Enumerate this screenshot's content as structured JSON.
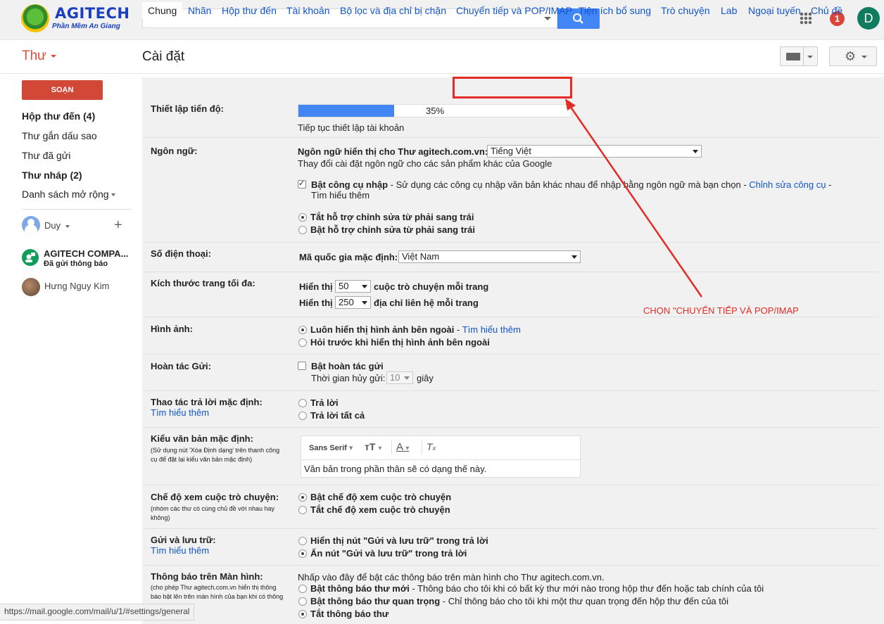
{
  "header": {
    "logo_title": "AGITECH",
    "logo_subtitle": "Phần Mềm An Giang",
    "notification_count": "1",
    "avatar_letter": "D"
  },
  "subheader": {
    "app_title": "Thư",
    "page_title": "Cài đặt"
  },
  "sidebar": {
    "compose_label": "SOẠN",
    "items": [
      {
        "label": "Hộp thư đến (4)",
        "bold": true
      },
      {
        "label": "Thư gắn dấu sao",
        "bold": false
      },
      {
        "label": "Thư đã gửi",
        "bold": false
      },
      {
        "label": "Thư nháp (2)",
        "bold": true
      },
      {
        "label": "Danh sách mở rộng",
        "bold": false
      }
    ],
    "hangouts_user": "Duy",
    "contacts": [
      {
        "name": "AGITECH COMPA...",
        "status": "Đã gửi thông báo"
      },
      {
        "name": "Hưng Nguy Kim",
        "status": ""
      }
    ]
  },
  "tabs": [
    {
      "label": "Chung",
      "active": true
    },
    {
      "label": "Nhãn"
    },
    {
      "label": "Hộp thư đến"
    },
    {
      "label": "Tài khoản"
    },
    {
      "label": "Bộ lọc và địa chỉ bị chặn"
    },
    {
      "label": "Chuyển tiếp và POP/IMAP",
      "highlighted": true
    },
    {
      "label": "Tiện ích bổ sung"
    },
    {
      "label": "Trò chuyện"
    },
    {
      "label": "Lab"
    },
    {
      "label": "Ngoại tuyến"
    },
    {
      "label": "Chủ đề"
    }
  ],
  "settings": {
    "progress": {
      "label": "Thiết lập tiến độ:",
      "percent_value": 35,
      "percent_text": "35%",
      "link": "Tiếp tục thiết lập tài khoản"
    },
    "language": {
      "label": "Ngôn ngữ:",
      "display_label": "Ngôn ngữ hiển thị cho Thư agitech.com.vn:",
      "display_value": "Tiếng Việt",
      "change_link": "Thay đổi cài đặt ngôn ngữ cho các sản phẩm khác của Google",
      "input_tools_bold": "Bật công cụ nhập",
      "input_tools_text": " - Sử dụng các công cụ nhập văn bản khác nhau để nhập bằng ngôn ngữ mà bạn chọn - ",
      "input_tools_link": "Chỉnh sửa công cụ",
      "input_tools_dash": " -",
      "learn_more": "Tìm hiểu thêm",
      "rtl_off": "Tắt hỗ trợ chỉnh sửa từ phải sang trái",
      "rtl_on": "Bật hỗ trợ chỉnh sửa từ phải sang trái"
    },
    "phone": {
      "label": "Số điện thoại:",
      "country_label": "Mã quốc gia mặc định:",
      "country_value": "Việt Nam"
    },
    "page_size": {
      "label": "Kích thước trang tối đa:",
      "show": "Hiển thị",
      "conv_value": "50",
      "conv_text": "cuộc trò chuyện mỗi trang",
      "contacts_value": "250",
      "contacts_text": "địa chỉ liên hệ mỗi trang"
    },
    "images": {
      "label": "Hình ảnh:",
      "always": "Luôn hiển thị hình ảnh bên ngoài",
      "always_sep": " - ",
      "learn_more": "Tìm hiểu thêm",
      "ask": "Hỏi trước khi hiển thị hình ảnh bên ngoài"
    },
    "undo_send": {
      "label": "Hoàn tác Gửi:",
      "enable": "Bật hoàn tác gửi",
      "period_label": "Thời gian hủy gửi:",
      "period_value": "10",
      "seconds": "giây"
    },
    "reply": {
      "label": "Thao tác trả lời mặc định:",
      "learn_more": "Tìm hiểu thêm",
      "reply": "Trả lời",
      "reply_all": "Trả lời tất cả"
    },
    "text_style": {
      "label": "Kiểu văn bản mặc định:",
      "sub": "(Sử dụng nút 'Xóa Định dạng' trên thanh công cụ để đặt lại kiểu văn bản mặc định)",
      "font": "Sans Serif",
      "preview": "Văn bản trong phần thân sẽ có dạng thế này."
    },
    "conversation": {
      "label": "Chế độ xem cuộc trò chuyện:",
      "sub": "(nhóm các thư có cùng chủ đề với nhau hay không)",
      "on": "Bật chế độ xem cuộc trò chuyện",
      "off": "Tắt chế độ xem cuộc trò chuyện"
    },
    "send_archive": {
      "label": "Gửi và lưu trữ:",
      "learn_more": "Tìm hiểu thêm",
      "show": "Hiển thị nút \"Gửi và lưu trữ\" trong trả lời",
      "hide": "Ẩn nút \"Gửi và lưu trữ\" trong trả lời"
    },
    "desktop_notif": {
      "label": "Thông báo trên Màn hình:",
      "sub": "(cho phép Thư agitech.com.vn hiển thị thông báo bật lên trên màn hình của bạn khi có thông",
      "enable_link": "Nhấp vào đây để bật các thông báo trên màn hình cho Thư agitech.com.vn.",
      "new_mail_bold": "Bật thông báo thư mới",
      "new_mail_text": " - Thông báo cho tôi khi có bất kỳ thư mới nào trong hộp thư đến hoặc tab chính của tôi",
      "important_bold": "Bật thông báo thư quan trọng",
      "important_text": " - Chỉ thông báo cho tôi khi một thư quan trọng đến hộp thư đến của tôi",
      "off": "Tắt thông báo thư"
    }
  },
  "annotation": "CHỌN \"CHUYỂN TIẾP VÀ POP/IMAP",
  "status_url": "https://mail.google.com/mail/u/1/#settings/general",
  "colors": {
    "accent": "#4285f4",
    "compose": "#d14836",
    "highlight": "#e52b25",
    "link": "#1155cc"
  }
}
